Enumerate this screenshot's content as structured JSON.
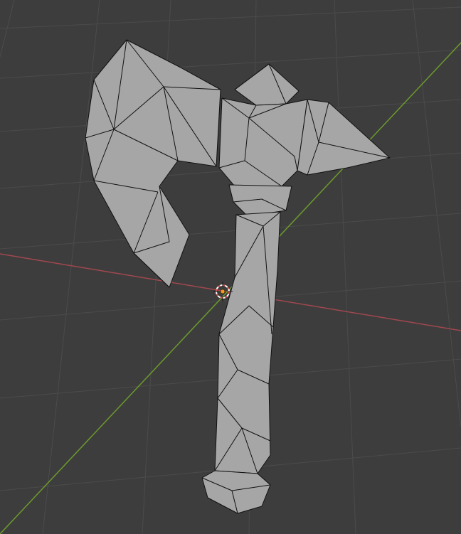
{
  "viewport": {
    "background": "#3d3d3d",
    "grid_color": "#4a4a4a",
    "x_axis_color": "#a2474f",
    "y_axis_color": "#6c9a2c",
    "mesh_fill": "#a6a6a6",
    "mesh_edge": "#111111",
    "origin_icon": "3d-cursor-icon",
    "object_icon": "axe-mesh-icon"
  }
}
